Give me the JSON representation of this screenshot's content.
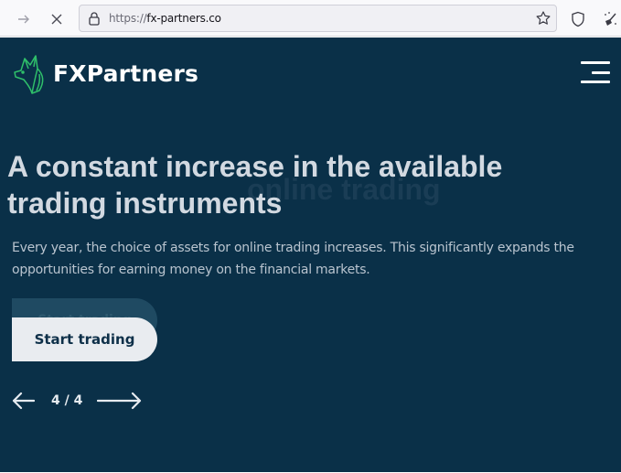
{
  "browser": {
    "url_scheme": "https://",
    "url_host": "fx-partners.co",
    "icons": [
      "forward-icon",
      "stop-icon",
      "lock-icon",
      "bookmark-star-icon",
      "shield-icon",
      "extension-broom-icon"
    ]
  },
  "header": {
    "brand": "FXPartners",
    "logo_icon": "wolf-head-icon",
    "menu_icon": "hamburger-menu-icon"
  },
  "hero": {
    "ghost_title": "online trading",
    "title": "A constant increase in the available trading instruments",
    "description": "Every year, the choice of assets for online trading increases. This significantly expands the opportunities for earning money on the financial markets.",
    "cta_ghost_label": "Start trading",
    "cta_label": "Start trading"
  },
  "slider": {
    "current": 4,
    "total": 4,
    "counter_text": "4 / 4",
    "prev_icon": "arrow-left-icon",
    "next_icon": "arrow-right-icon"
  },
  "colors": {
    "page_bg": "#0a3048",
    "accent_green": "#2ecc71",
    "button_bg": "#e9ecf0",
    "title_color": "#d2d9e1"
  }
}
